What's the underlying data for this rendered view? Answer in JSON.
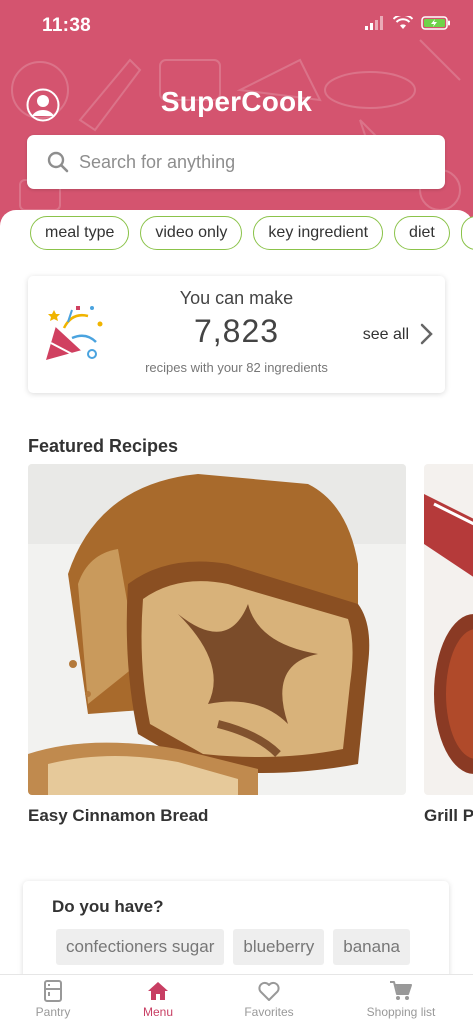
{
  "status_bar": {
    "time": "11:38"
  },
  "header": {
    "app_title": "SuperCook",
    "search_placeholder": "Search for anything",
    "brand_color": "#d4546f"
  },
  "filters": [
    {
      "label": "meal type"
    },
    {
      "label": "video only"
    },
    {
      "label": "key ingredient"
    },
    {
      "label": "diet"
    }
  ],
  "make_card": {
    "title": "You can make",
    "count": "7,823",
    "see_all": "see all",
    "subtitle": "recipes with your 82 ingredients"
  },
  "featured": {
    "title": "Featured Recipes",
    "recipes": [
      {
        "name": "Easy Cinnamon Bread"
      },
      {
        "name": "Grill P"
      }
    ]
  },
  "do_you_have": {
    "title": "Do you have?",
    "items": [
      "confectioners sugar",
      "blueberry",
      "banana"
    ]
  },
  "tabbar": {
    "items": [
      {
        "label": "Pantry",
        "icon": "pantry-icon"
      },
      {
        "label": "Menu",
        "icon": "home-icon"
      },
      {
        "label": "Favorites",
        "icon": "heart-icon"
      },
      {
        "label": "Shopping list",
        "icon": "cart-icon"
      }
    ],
    "active": "Menu",
    "active_color": "#c83e63"
  }
}
